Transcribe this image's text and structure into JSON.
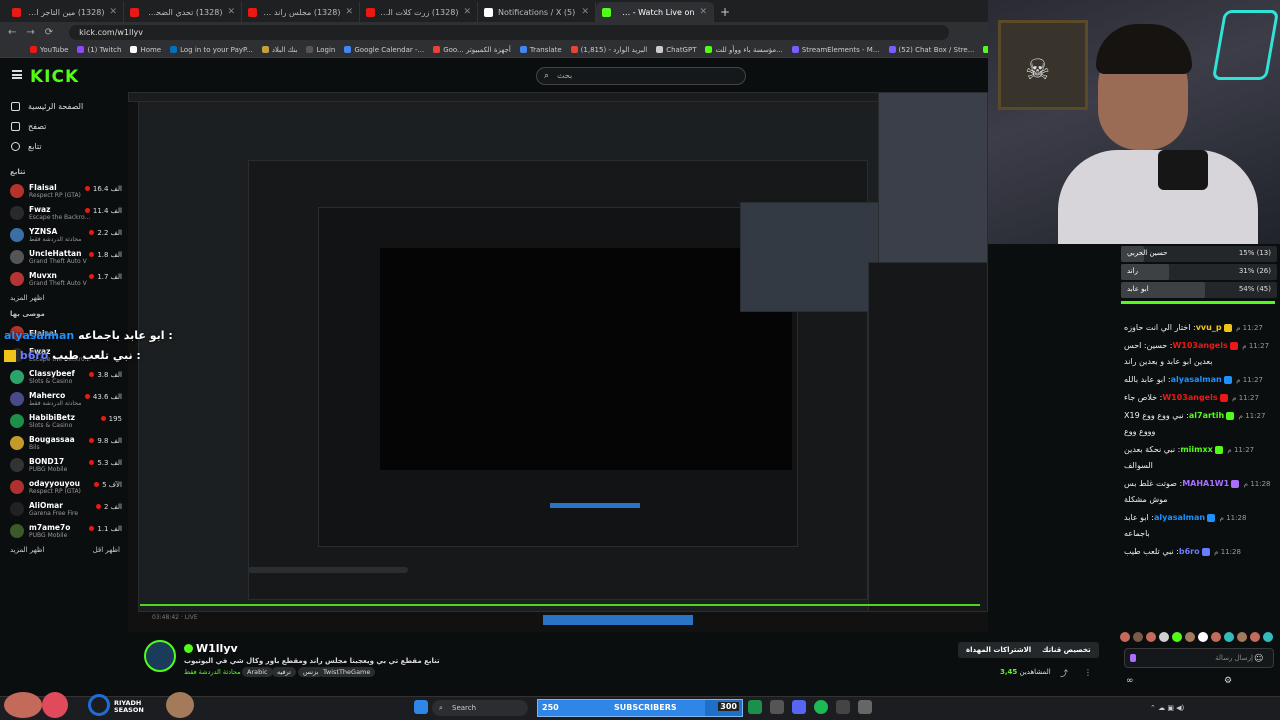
{
  "browser": {
    "tabs": [
      {
        "label": "(1328) مين التاجر الأفضل بين أن...",
        "color": "#e91916"
      },
      {
        "label": "(1328) تحدي الضحك + الحرف ف...",
        "color": "#e91916"
      },
      {
        "label": "(1328) مجلس راند سوالف وموات...",
        "color": "#e91916"
      },
      {
        "label": "(1328) زرت كلات السعودية ادو...",
        "color": "#e91916"
      },
      {
        "label": "(5) Notifications / X",
        "color": "#ffffff"
      },
      {
        "label": "W1llyv Stream - Watch Live on...",
        "color": "#53fc18"
      }
    ],
    "url": "kick.com/w1llyv",
    "bookmarks": [
      {
        "label": "YouTube",
        "color": "#e91916"
      },
      {
        "label": "(1) Twitch",
        "color": "#9146ff"
      },
      {
        "label": "Home",
        "color": "#ffffff"
      },
      {
        "label": "Log in to your PayP...",
        "color": "#0070ba"
      },
      {
        "label": "بنك البلاد",
        "color": "#c4a13a"
      },
      {
        "label": "Login",
        "color": "#555555"
      },
      {
        "label": "Google Calendar -...",
        "color": "#4285f4"
      },
      {
        "label": "Goo... أجهزة الكمبيوتر",
        "color": "#ea4335"
      },
      {
        "label": "Translate",
        "color": "#4285f4"
      },
      {
        "label": "البريد الوارد - (1,815)",
        "color": "#ea4335"
      },
      {
        "label": "ChatGPT",
        "color": "#cccccc"
      },
      {
        "label": "مؤسسة باء ووأو للت...",
        "color": "#53fc18"
      },
      {
        "label": "StreamElements - M...",
        "color": "#7b5cff"
      },
      {
        "label": "(52) Chat Box / Stre...",
        "color": "#7b5cff"
      },
      {
        "label": "w1llyv - Kick Stats...",
        "color": "#53fc18"
      },
      {
        "label": "Kick",
        "color": "#53fc18"
      },
      {
        "label": "botrix",
        "color": "#e91916"
      }
    ]
  },
  "header": {
    "logo": "KICK",
    "search_placeholder": "بحث"
  },
  "sidebar": {
    "nav": [
      "الصفحة الرئيسية",
      "تصفح",
      "تتابع"
    ],
    "section_title": "تتابع",
    "channels": [
      {
        "name": "FIaisal",
        "game": "Respect RP (GTA)",
        "viewers": "16.4 الف",
        "color": "#b5332b"
      },
      {
        "name": "Fwaz",
        "game": "Escape the Backro...",
        "viewers": "11.4 الف",
        "color": "#2a2a2a"
      },
      {
        "name": "YZNSA",
        "game": "محادثة الدردشة فقط",
        "viewers": "2.2 الف",
        "color": "#3b6ea5"
      },
      {
        "name": "UncleHattan",
        "game": "Grand Theft Auto V",
        "viewers": "1.8 الف",
        "color": "#555555"
      },
      {
        "name": "Muvxn",
        "game": "Grand Theft Auto V",
        "viewers": "1.7 الف",
        "color": "#b53434"
      }
    ],
    "more1": "اظهر المزيد",
    "section2_title": "موصى بها",
    "channels2": [
      {
        "name": "FIaisal",
        "game": "",
        "viewers": "",
        "color": "#b5332b"
      },
      {
        "name": "Fwaz",
        "game": "Escape the Backro...",
        "viewers": "",
        "color": "#2a2a2a"
      },
      {
        "name": "Classybeef",
        "game": "Slots & Casino",
        "viewers": "3.8 الف",
        "color": "#2ba36b"
      },
      {
        "name": "Maherco",
        "game": "محادثة الدردشة فقط",
        "viewers": "43.6 الف",
        "color": "#4a4a8a"
      },
      {
        "name": "HabibiBetz",
        "game": "Slots & Casino",
        "viewers": "195",
        "color": "#1c8f4a"
      },
      {
        "name": "Bougassaa",
        "game": "Bils",
        "viewers": "9.8 الف",
        "color": "#c49a2a"
      },
      {
        "name": "BOND17",
        "game": "PUBG Mobile",
        "viewers": "5.3 الف",
        "color": "#333333"
      },
      {
        "name": "odayyouyou",
        "game": "Respect RP (GTA)",
        "viewers": "5 الآف",
        "color": "#b03030"
      },
      {
        "name": "AliOmar",
        "game": "Garena Free Fire",
        "viewers": "2 الف",
        "color": "#222222"
      },
      {
        "name": "m7ame7o",
        "game": "PUBG Mobile",
        "viewers": "1.1 الف",
        "color": "#3a5a2a"
      }
    ],
    "more2": "اظهر المزيد",
    "more2_right": "اظهر اقل"
  },
  "overlay_chat": [
    {
      "user": "alyasalman",
      "text": "ابو عابد باجماعه :",
      "color": "#1e90ff"
    },
    {
      "user": "b6ro",
      "text": "نبي تلعب طيب :",
      "color": "#6a7cff"
    }
  ],
  "poll": {
    "options": [
      {
        "label": "حسين الحربي",
        "pct": "15% (13)",
        "value": 0.15
      },
      {
        "label": "راند",
        "pct": "31% (26)",
        "value": 0.31
      },
      {
        "label": "ابو عابد",
        "pct": "54% (45)",
        "value": 0.54
      }
    ]
  },
  "chat": {
    "messages": [
      {
        "time": "11:27 م",
        "user": "vvu_p",
        "text": "اختار الي انت حاوزه",
        "color": "#f0c419"
      },
      {
        "time": "11:27 م",
        "user": "W103angels",
        "text": "حسين: احس بعدين ابو عابد و بعدين راند",
        "color": "#e91916"
      },
      {
        "time": "11:27 م",
        "user": "alyasalman",
        "text": "ابو عابد بالله",
        "color": "#1e90ff"
      },
      {
        "time": "11:27 م",
        "user": "W103angels",
        "text": "خلاص جاء",
        "color": "#e91916"
      },
      {
        "time": "11:27 م",
        "user": "al7artih",
        "text": "نبي ووع ووع X19 وووع ووع",
        "color": "#53fc18"
      },
      {
        "time": "11:27 م",
        "user": "miimxx",
        "text": "نبي نحكة بعدين السوالف",
        "color": "#53fc18"
      },
      {
        "time": "11:28 م",
        "user": "MAHA1W1",
        "text": "صوتت غلط بس موش مشكلة",
        "color": "#a970ff"
      },
      {
        "time": "11:28 م",
        "user": "alyasalman",
        "text": "ابو عابد باجماعه",
        "color": "#1e90ff"
      },
      {
        "time": "11:28 م",
        "user": "b6ro",
        "text": "نبي تلعب طيب",
        "color": "#6a7cff"
      }
    ],
    "input_placeholder": "إرسال رسالة"
  },
  "stream": {
    "channel": "W1llyv",
    "title": "تنابع مقطع تي بي ويعجبنا مجلس راند ومقطع باور وكال شي في اليوتيوب",
    "category": "محادثة الدردشة فقط",
    "tags": [
      "Arabic",
      "ترفيه",
      "بزنس",
      "TwistTheGame"
    ],
    "subscribe_label": "الاشتراكات المهداة",
    "follow_label": "تخصيص قناتك",
    "viewers_label": "3,45",
    "viewers_suffix": "المشاهدين"
  },
  "taskbar": {
    "search": "Search",
    "sub_low": "250",
    "sub_mid": "SUBSCRIBERS",
    "sub_high": "300",
    "sub_progress": 0.82,
    "riyadh": "RIYADH SEASON",
    "video_time": "03:48:42",
    "live_label": "LIVE"
  }
}
